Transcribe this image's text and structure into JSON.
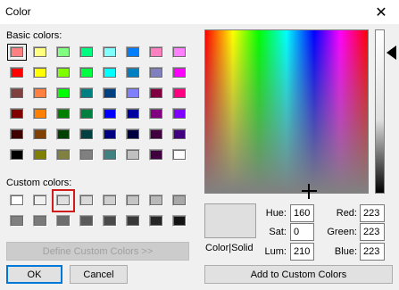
{
  "window": {
    "title": "Color",
    "close_glyph": "✕"
  },
  "basic_colors": {
    "label": "Basic colors:",
    "rows": [
      [
        "#ff8080",
        "#ffff80",
        "#80ff80",
        "#00ff80",
        "#80ffff",
        "#0080ff",
        "#ff80c0",
        "#ff80ff"
      ],
      [
        "#ff0000",
        "#ffff00",
        "#80ff00",
        "#00ff40",
        "#00ffff",
        "#0080c0",
        "#8080c0",
        "#ff00ff"
      ],
      [
        "#804040",
        "#ff8040",
        "#00ff00",
        "#008080",
        "#004080",
        "#8080ff",
        "#800040",
        "#ff0080"
      ],
      [
        "#800000",
        "#ff8000",
        "#008000",
        "#008040",
        "#0000ff",
        "#0000a0",
        "#800080",
        "#8000ff"
      ],
      [
        "#400000",
        "#804000",
        "#004000",
        "#004040",
        "#000080",
        "#000040",
        "#400040",
        "#400080"
      ],
      [
        "#000000",
        "#808000",
        "#808040",
        "#808080",
        "#408080",
        "#c0c0c0",
        "#400040",
        "#ffffff"
      ]
    ],
    "selected": "#ff8080"
  },
  "custom_colors": {
    "label": "Custom colors:",
    "rows": [
      [
        "#ffffff",
        "#f0f0f0",
        "#dfdfdf",
        "#d9d9d9",
        "#cfcfcf",
        "#c4c4c4",
        "#b9b9b9",
        "#a8a8a8"
      ],
      [
        "#808080",
        "#7a7a7a",
        "#6e6e6e",
        "#5a5a5a",
        "#4a4a4a",
        "#383838",
        "#262626",
        "#141414"
      ]
    ],
    "selected": "#dfdfdf"
  },
  "buttons": {
    "define_custom": "Define Custom Colors >>",
    "ok": "OK",
    "cancel": "Cancel",
    "add_custom": "Add to Custom Colors"
  },
  "preview": {
    "label": "Color|Solid",
    "color": "#dfdfdf"
  },
  "fields": {
    "hue": {
      "label": "Hue:",
      "value": "160"
    },
    "sat": {
      "label": "Sat:",
      "value": "0"
    },
    "lum": {
      "label": "Lum:",
      "value": "210"
    },
    "red": {
      "label": "Red:",
      "value": "223"
    },
    "green": {
      "label": "Green:",
      "value": "223"
    },
    "blue": {
      "label": "Blue:",
      "value": "223"
    }
  }
}
